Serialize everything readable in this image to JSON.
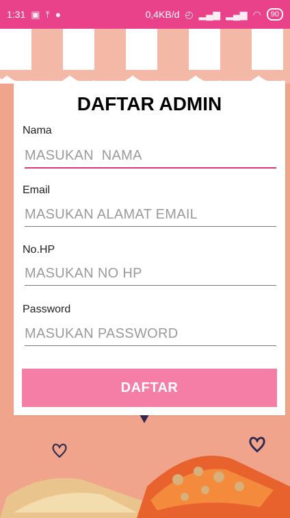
{
  "status_bar": {
    "time": "1:31",
    "network_speed": "0,4KB/d",
    "battery": "90",
    "icons": [
      "gallery-icon",
      "upload-icon",
      "app-icon",
      "alarm-icon",
      "signal-icon",
      "signal-icon",
      "wifi-icon",
      "battery-icon"
    ]
  },
  "form": {
    "title": "DAFTAR ADMIN",
    "name": {
      "label": "Nama",
      "placeholder": "MASUKAN  NAMA"
    },
    "email": {
      "label": "Email",
      "placeholder": "MASUKAN ALAMAT EMAIL"
    },
    "phone": {
      "label": "No.HP",
      "placeholder": "MASUKAN NO HP"
    },
    "password": {
      "label": "Password",
      "placeholder": "MASUKAN PASSWORD"
    },
    "submit_label": "DAFTAR"
  },
  "colors": {
    "status_bar": "#e9428a",
    "background": "#f0a48b",
    "button": "#f57ea7",
    "focus_underline": "#d43a78"
  }
}
